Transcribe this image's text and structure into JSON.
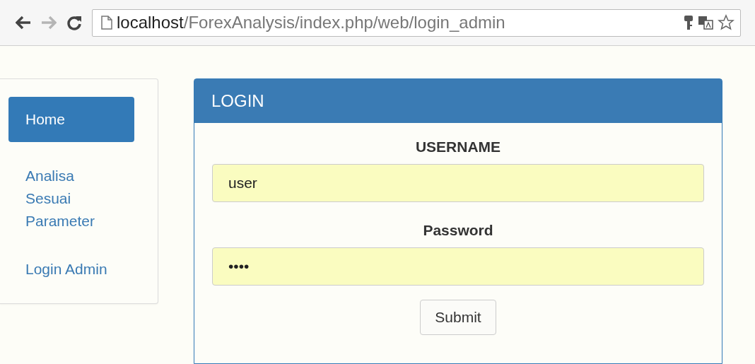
{
  "browser": {
    "back_disabled": false,
    "forward_disabled": true,
    "url_host": "localhost",
    "url_path": "/ForexAnalysis/index.php/web/login_admin"
  },
  "sidebar": {
    "items": [
      {
        "label": "Home",
        "selected": true
      },
      {
        "label": "Analisa Sesuai Parameter",
        "selected": false
      },
      {
        "label": "Login Admin",
        "selected": false
      }
    ]
  },
  "login": {
    "title": "LOGIN",
    "fields": [
      {
        "label": "USERNAME",
        "value": "user"
      },
      {
        "label": "Password",
        "value": "••••"
      }
    ],
    "submit": "Submit"
  }
}
